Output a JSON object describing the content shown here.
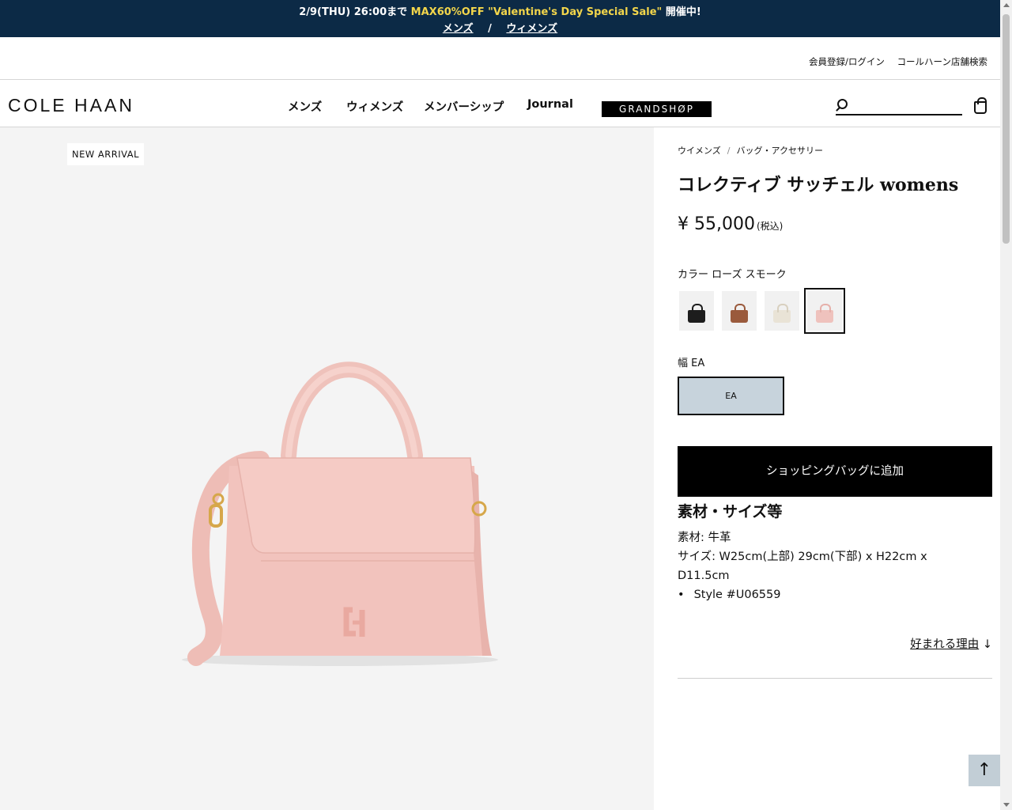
{
  "promo": {
    "prefix": "2/9(THU) 26:00まで",
    "highlight": "MAX60%OFF \"Valentine's Day Special Sale\"",
    "suffix": "開催中!",
    "link_mens": "メンズ",
    "separator": "/",
    "link_womens": "ウィメンズ",
    "bg_color": "#0c2a46",
    "highlight_color": "#f3d64b"
  },
  "utility": {
    "register_login": "会員登録/ログイン",
    "store_search": "コールハーン店舗検索"
  },
  "header": {
    "logo": "COLE HAAN",
    "nav": [
      "メンズ",
      "ウィメンズ",
      "メンバーシップ",
      "Journal"
    ],
    "grandshop": "GRANDSHØP",
    "search_placeholder": ""
  },
  "gallery": {
    "badge": "NEW ARRIVAL",
    "bag_color": "#f2c3bd"
  },
  "product": {
    "breadcrumb": [
      "ウイメンズ",
      "バッグ・アクセサリー"
    ],
    "title": "コレクティブ サッチェル womens",
    "price": "¥ 55,000",
    "tax_note": "(税込)",
    "color_label": "カラー ローズ スモーク",
    "swatches": [
      {
        "name": "black",
        "color": "#1d1d1d",
        "selected": false
      },
      {
        "name": "brown",
        "color": "#9a5a3c",
        "selected": false
      },
      {
        "name": "ivory",
        "color": "#e9e3d6",
        "selected": false
      },
      {
        "name": "rose-smoke",
        "color": "#efc2bd",
        "selected": true
      }
    ],
    "width_label": "幅 EA",
    "width_option": "EA",
    "add_to_bag": "ショッピングバッグに追加",
    "details_heading": "素材・サイズ等",
    "material": "素材: 牛革",
    "size": "サイズ: W25cm(上部) 29cm(下部) x H22cm x D11.5cm",
    "style": "Style #U06559",
    "why_link": "好まれる理由",
    "why_arrow": "↓"
  },
  "back_to_top": "↑"
}
